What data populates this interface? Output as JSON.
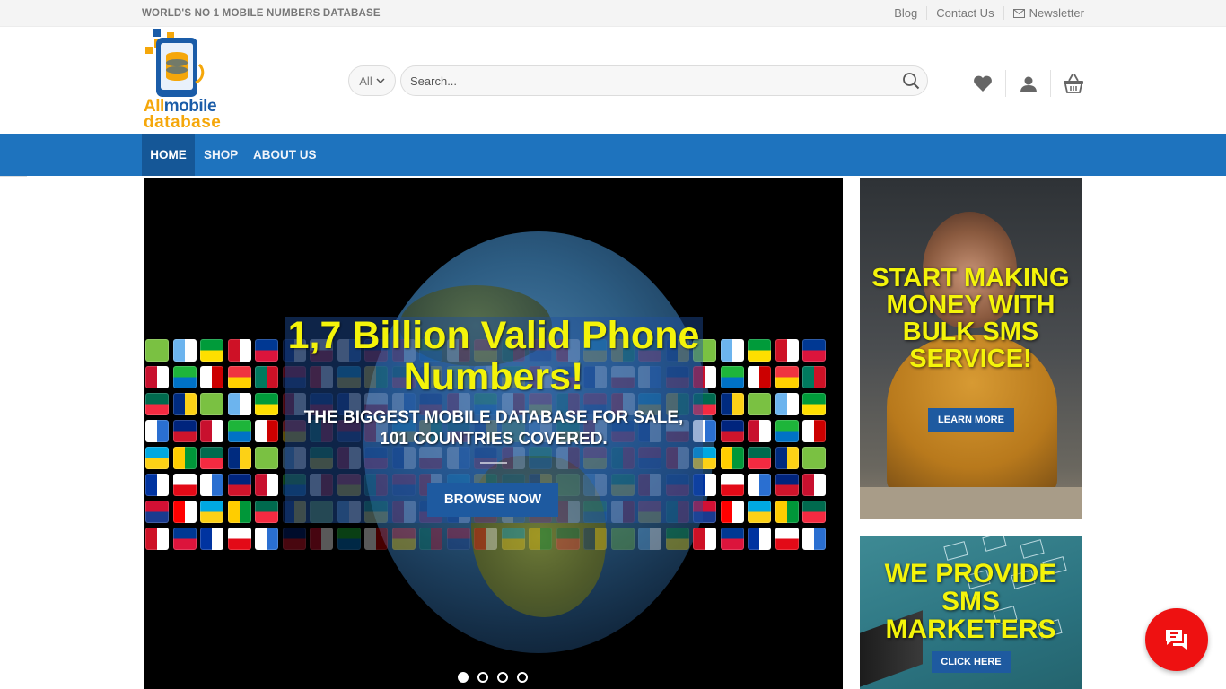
{
  "topbar": {
    "tagline": "WORLD'S NO 1 MOBILE NUMBERS DATABASE",
    "links": [
      "Blog",
      "Contact Us",
      "Newsletter"
    ]
  },
  "logo": {
    "word1_a": "All",
    "word1_b": "mobile",
    "word2": "database"
  },
  "search": {
    "category": "All",
    "placeholder": "Search..."
  },
  "header_icons": [
    "heart-icon",
    "user-icon",
    "basket-icon"
  ],
  "nav": {
    "items": [
      "HOME",
      "SHOP",
      "ABOUT US"
    ],
    "active": "HOME"
  },
  "slider": {
    "title": "1,7 Billion Valid Phone Numbers!",
    "subtitle_line1": "THE BIGGEST MOBILE DATABASE FOR SALE,",
    "subtitle_line2": "101 COUNTRIES COVERED.",
    "button": "BROWSE NOW",
    "slide_count": 4,
    "active_slide": 1
  },
  "ads": [
    {
      "title": "START MAKING MONEY WITH BULK SMS SERVICE!",
      "button": "LEARN MORE"
    },
    {
      "title": "WE PROVIDE SMS MARKETERS",
      "button": "CLICK HERE"
    }
  ],
  "colors": {
    "nav_bg": "#1e73be",
    "nav_active": "#155797",
    "headline_yellow": "#f4f40a",
    "button_blue": "#1e5aa0",
    "chat_red": "#ee1111"
  }
}
